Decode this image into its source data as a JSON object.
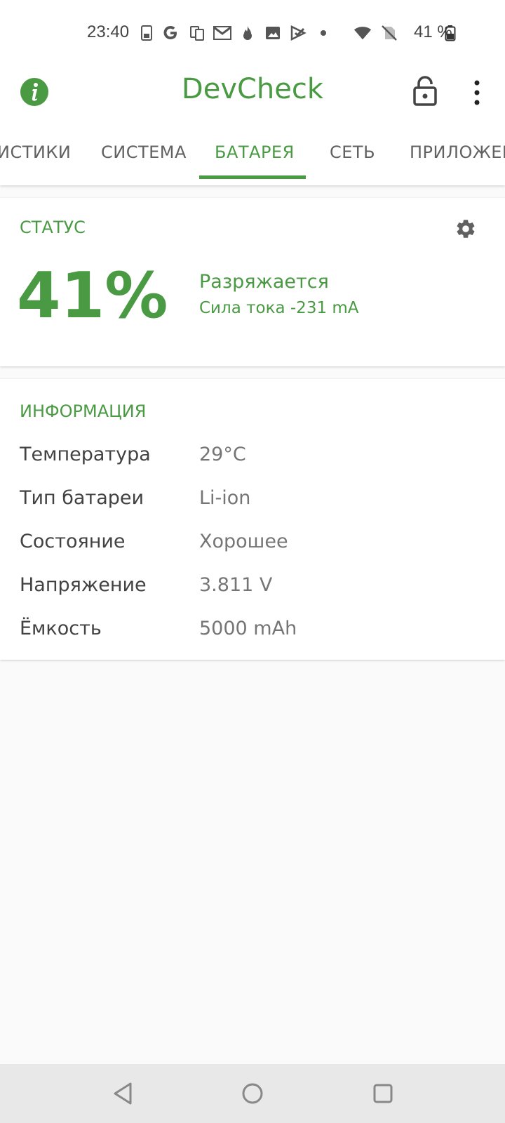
{
  "status_bar": {
    "time": "23:40",
    "battery_pct": "41 %",
    "icons": [
      "sim-card-icon",
      "google-icon",
      "copy-devices-icon",
      "gmail-icon",
      "fire-icon",
      "image-icon",
      "play-check-icon",
      "dot-icon",
      "wifi-icon",
      "no-sim-icon",
      "battery-icon"
    ]
  },
  "toolbar": {
    "title": "DevCheck",
    "info_icon": "info-icon",
    "lock_icon": "lock-icon",
    "more_icon": "more-vert-icon",
    "accent_color": "#4a9a44"
  },
  "tabs": [
    {
      "label": "ИСТИКИ"
    },
    {
      "label": "СИСТЕМА"
    },
    {
      "label": "БАТАРЕЯ",
      "active": true
    },
    {
      "label": "СЕТЬ"
    },
    {
      "label": "ПРИЛОЖЕН"
    }
  ],
  "status_card": {
    "title": "СТАТУС",
    "level": "41%",
    "state": "Разряжается",
    "current": "Сила тока -231 mA",
    "settings_icon": "gear-icon"
  },
  "info_card": {
    "title": "ИНФОРМАЦИЯ",
    "rows": [
      {
        "label": "Температура",
        "value": "29°C"
      },
      {
        "label": "Тип батареи",
        "value": "Li-ion"
      },
      {
        "label": "Состояние",
        "value": "Хорошее"
      },
      {
        "label": "Напряжение",
        "value": "3.811 V"
      },
      {
        "label": "Ёмкость",
        "value": "5000 mAh"
      }
    ]
  },
  "nav_bar": {
    "back": "back-icon",
    "home": "home-icon",
    "recents": "recents-icon"
  }
}
